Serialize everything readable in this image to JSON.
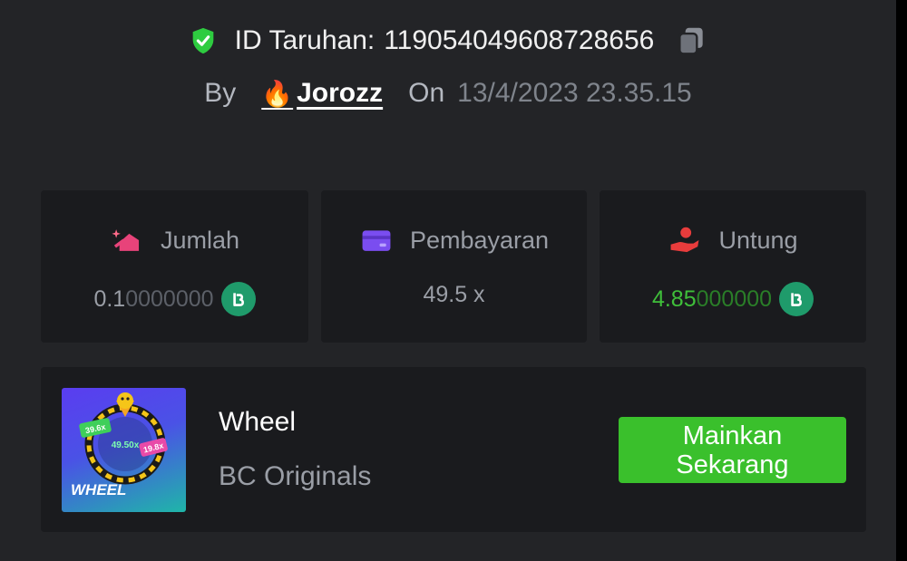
{
  "header": {
    "bet_id_label": "ID Taruhan:",
    "bet_id_value": "119054049608728656",
    "by_label": "By",
    "username": "Jorozz",
    "user_emoji": "🔥",
    "on_label": "On",
    "date": "13/4/2023 23.35.15"
  },
  "stats": [
    {
      "label": "Jumlah",
      "value_bright": "0.1",
      "value_dim": "0000000",
      "icon": "bet-amount-icon",
      "currency_icon": "bc-coin-icon",
      "value_color": "#9a9ea6"
    },
    {
      "label": "Pembayaran",
      "value": "49.5 x",
      "icon": "payout-card-icon"
    },
    {
      "label": "Untung",
      "value_bright": "4.85",
      "value_dim": "000000",
      "icon": "profit-hand-icon",
      "currency_icon": "bc-coin-icon",
      "value_color": "#3fbf3a"
    }
  ],
  "game": {
    "title": "Wheel",
    "provider": "BC Originals",
    "thumb_label": "WHEEL",
    "thumb_multiplier_center": "49.50x",
    "thumb_multiplier_left": "39.6x",
    "thumb_multiplier_right": "19.8x",
    "play_button": "Mainkan Sekarang"
  },
  "colors": {
    "background": "#232427",
    "card": "#1a1b1e",
    "accent_green": "#3ac02c",
    "profit_green": "#3fbf3a",
    "shield_green": "#2ecc40",
    "coin_teal": "#1f9b6b"
  }
}
